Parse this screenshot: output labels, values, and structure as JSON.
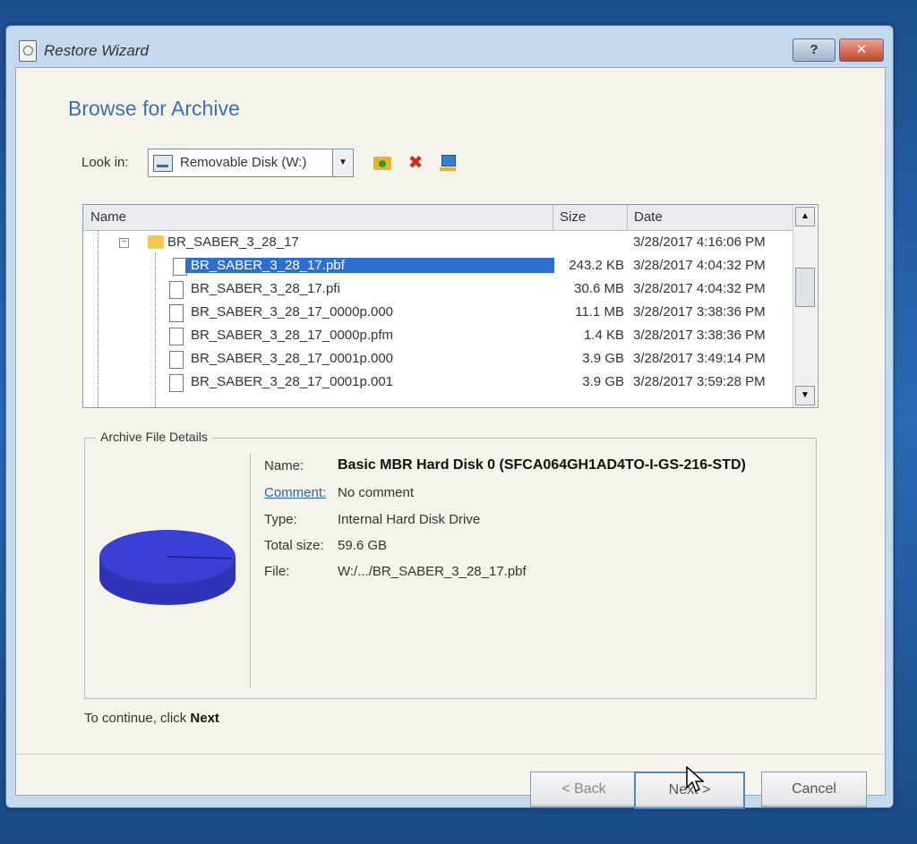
{
  "window": {
    "title": "Restore Wizard",
    "help_label": "?",
    "close_label": "✕"
  },
  "page": {
    "heading": "Browse for Archive"
  },
  "lookin": {
    "label": "Look in:",
    "value": "Removable Disk (W:)",
    "dropdown_glyph": "▼"
  },
  "toolbar": {
    "up_icon": "folder-up-icon",
    "delete_icon": "delete-icon",
    "network_icon": "network-icon",
    "delete_glyph": "✖"
  },
  "table": {
    "columns": [
      "Name",
      "Size",
      "Date"
    ],
    "folder": {
      "name": "BR_SABER_3_28_17",
      "date": "3/28/2017 4:16:06 PM"
    },
    "rows": [
      {
        "name": "BR_SABER_3_28_17.pbf",
        "size": "243.2 KB",
        "date": "3/28/2017 4:04:32 PM"
      },
      {
        "name": "BR_SABER_3_28_17.pfi",
        "size": "30.6 MB",
        "date": "3/28/2017 4:04:32 PM"
      },
      {
        "name": "BR_SABER_3_28_17_0000p.000",
        "size": "11.1 MB",
        "date": "3/28/2017 3:38:36 PM"
      },
      {
        "name": "BR_SABER_3_28_17_0000p.pfm",
        "size": "1.4 KB",
        "date": "3/28/2017 3:38:36 PM"
      },
      {
        "name": "BR_SABER_3_28_17_0001p.000",
        "size": "3.9 GB",
        "date": "3/28/2017 3:49:14 PM"
      },
      {
        "name": "BR_SABER_3_28_17_0001p.001",
        "size": "3.9 GB",
        "date": "3/28/2017 3:59:28 PM"
      }
    ],
    "scroll_up_glyph": "▲",
    "scroll_down_glyph": "▼"
  },
  "details": {
    "group_label": "Archive File Details",
    "name_label": "Name:",
    "name_value": "Basic MBR Hard Disk 0 (SFCA064GH1AD4TO-I-GS-216-STD)",
    "comment_label": "Comment:",
    "comment_value": "No comment",
    "type_label": "Type:",
    "type_value": "Internal Hard Disk Drive",
    "size_label": "Total size:",
    "size_value": "59.6 GB",
    "file_label": "File:",
    "file_value": "W:/.../BR_SABER_3_28_17.pbf"
  },
  "hint": {
    "prefix": "To continue, click ",
    "action": "Next"
  },
  "buttons": {
    "back": "< Back",
    "next": "Next >",
    "cancel": "Cancel"
  },
  "colors": {
    "accent": "#3b6fb0",
    "selection": "#2f6fd0",
    "disk": "#3a3fd6"
  }
}
